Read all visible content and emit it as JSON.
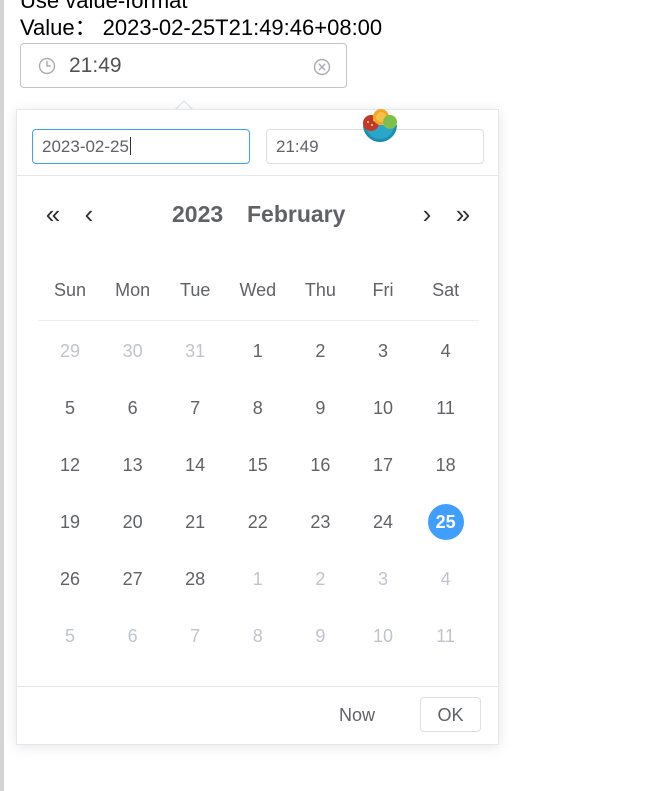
{
  "heading": "Use value-format",
  "value_line": {
    "label": "Value：",
    "value": "2023-02-25T21:49:46+08:00"
  },
  "trigger": {
    "text": "21:49",
    "prefix_icon": "clock-icon",
    "suffix_icon": "circle-close-icon"
  },
  "panel": {
    "date_input": "2023-02-25",
    "time_input": "21:49",
    "year": "2023",
    "month": "February",
    "weekdays": [
      "Sun",
      "Mon",
      "Tue",
      "Wed",
      "Thu",
      "Fri",
      "Sat"
    ],
    "weeks": [
      [
        "29",
        "30",
        "31",
        "1",
        "2",
        "3",
        "4"
      ],
      [
        "5",
        "6",
        "7",
        "8",
        "9",
        "10",
        "11"
      ],
      [
        "12",
        "13",
        "14",
        "15",
        "16",
        "17",
        "18"
      ],
      [
        "19",
        "20",
        "21",
        "22",
        "23",
        "24",
        "25"
      ],
      [
        "26",
        "27",
        "28",
        "1",
        "2",
        "3",
        "4"
      ],
      [
        "5",
        "6",
        "7",
        "8",
        "9",
        "10",
        "11"
      ]
    ],
    "selected_day": "25",
    "now_label": "Now",
    "ok_label": "OK"
  },
  "colors": {
    "accent": "#409eff",
    "muted_day": "#c0c4cc",
    "text": "#606266"
  }
}
